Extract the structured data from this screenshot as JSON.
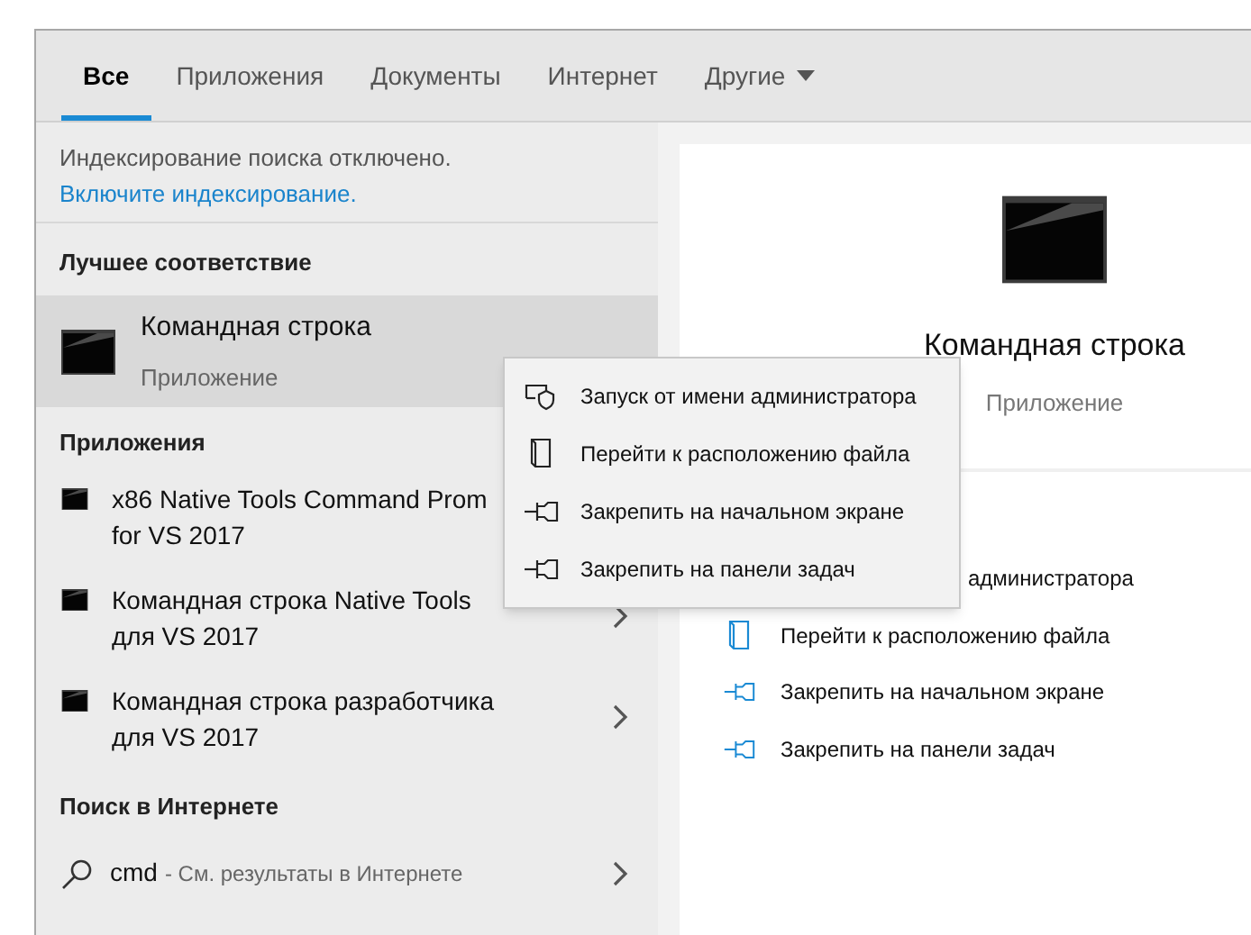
{
  "tabs": [
    {
      "label": "Все",
      "selected": true,
      "dropdown": false
    },
    {
      "label": "Приложения",
      "selected": false,
      "dropdown": false
    },
    {
      "label": "Документы",
      "selected": false,
      "dropdown": false
    },
    {
      "label": "Интернет",
      "selected": false,
      "dropdown": false
    },
    {
      "label": "Другие",
      "selected": false,
      "dropdown": true
    }
  ],
  "notice": {
    "text": "Индексирование поиска отключено.",
    "link": "Включите индексирование."
  },
  "best_match": {
    "heading": "Лучшее соответствие",
    "title": "Командная строка",
    "subtitle": "Приложение",
    "selected": true
  },
  "apps": {
    "heading": "Приложения",
    "items": [
      {
        "title": "x86 Native Tools Command Prom",
        "line2": "for VS 2017",
        "arrow": false
      },
      {
        "title": "Командная строка Native Tools",
        "line2": "для VS 2017",
        "arrow": true
      },
      {
        "title": "Командная строка разработчика",
        "line2": "для VS 2017",
        "arrow": true
      }
    ]
  },
  "web": {
    "heading": "Поиск в Интернете",
    "query": "cmd",
    "hint": "- См. результаты в Интернете",
    "arrow": true
  },
  "preview": {
    "title": "Командная строка",
    "subtitle": "Приложение",
    "actions": [
      {
        "label": "администратора"
      },
      {
        "kind": "folder",
        "label": "Перейти к расположению файла"
      },
      {
        "kind": "pin",
        "label": "Закрепить на начальном экране"
      },
      {
        "kind": "pin",
        "label": "Закрепить на панели задач"
      }
    ]
  },
  "context_menu": [
    {
      "kind": "admin",
      "label": "Запуск от имени администратора"
    },
    {
      "kind": "folder",
      "label": "Перейти к расположению файла"
    },
    {
      "kind": "pin",
      "label": "Закрепить на начальном экране"
    },
    {
      "kind": "pin",
      "label": "Закрепить на панели задач"
    }
  ]
}
